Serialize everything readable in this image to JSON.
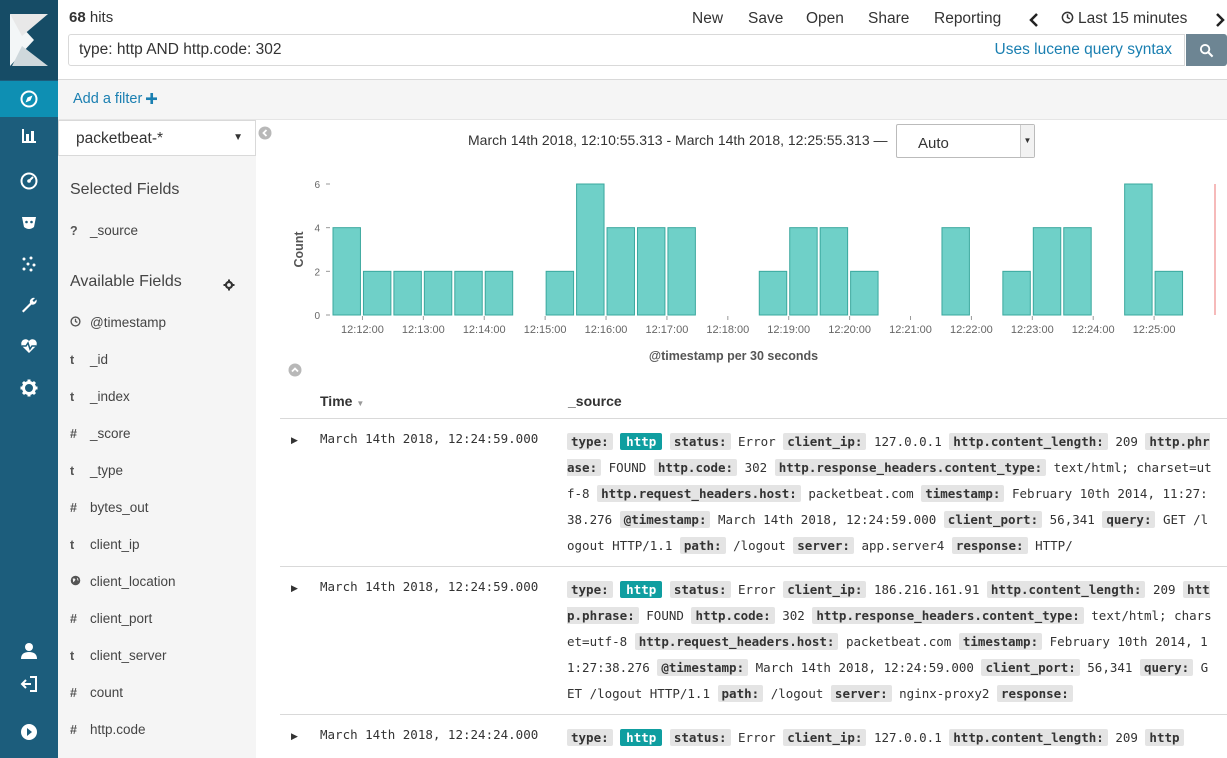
{
  "topbar": {
    "hits_count": "68",
    "hits_label": "hits",
    "links": [
      "New",
      "Save",
      "Open",
      "Share",
      "Reporting"
    ],
    "time_range": "Last 15 minutes",
    "query": "type: http AND http.code: 302",
    "lucene_link": "Uses lucene query syntax"
  },
  "filter_bar": {
    "add_filter": "Add a filter"
  },
  "sidebar": {
    "index_pattern": "packetbeat-*",
    "selected_heading": "Selected Fields",
    "selected_fields": [
      {
        "type": "?",
        "name": "_source"
      }
    ],
    "available_heading": "Available Fields",
    "available_fields": [
      {
        "type": "clock",
        "name": "@timestamp"
      },
      {
        "type": "t",
        "name": "_id"
      },
      {
        "type": "t",
        "name": "_index"
      },
      {
        "type": "#",
        "name": "_score"
      },
      {
        "type": "t",
        "name": "_type"
      },
      {
        "type": "#",
        "name": "bytes_out"
      },
      {
        "type": "t",
        "name": "client_ip"
      },
      {
        "type": "globe",
        "name": "client_location"
      },
      {
        "type": "#",
        "name": "client_port"
      },
      {
        "type": "t",
        "name": "client_server"
      },
      {
        "type": "#",
        "name": "count"
      },
      {
        "type": "#",
        "name": "http.code"
      }
    ]
  },
  "main": {
    "range_text": "March 14th 2018, 12:10:55.313 - March 14th 2018, 12:25:55.313 —",
    "interval": "Auto",
    "table_headers": {
      "time": "Time",
      "source": "_source"
    }
  },
  "colors": {
    "bar": "#6fd0c8",
    "bar_border": "#3aa89e",
    "nav": "#1c5d7c",
    "nav_active": "#0e8fb3",
    "link": "#1a7fb1",
    "highlight": "#0f9ea0"
  },
  "chart_data": {
    "type": "bar",
    "title": "",
    "xlabel": "@timestamp per 30 seconds",
    "ylabel": "Count",
    "ylim": [
      0,
      6
    ],
    "yticks": [
      0,
      2,
      4,
      6
    ],
    "x_ticks": [
      "12:12:00",
      "12:13:00",
      "12:14:00",
      "12:15:00",
      "12:16:00",
      "12:17:00",
      "12:18:00",
      "12:19:00",
      "12:20:00",
      "12:21:00",
      "12:22:00",
      "12:23:00",
      "12:24:00",
      "12:25:00"
    ],
    "categories": [
      "12:11:30",
      "12:12:00",
      "12:12:30",
      "12:13:00",
      "12:13:30",
      "12:14:00",
      "12:14:30",
      "12:15:00",
      "12:15:30",
      "12:16:00",
      "12:16:30",
      "12:17:00",
      "12:17:30",
      "12:18:00",
      "12:18:30",
      "12:19:00",
      "12:19:30",
      "12:20:00",
      "12:20:30",
      "12:21:00",
      "12:21:30",
      "12:22:00",
      "12:22:30",
      "12:23:00",
      "12:23:30",
      "12:24:00",
      "12:24:30",
      "12:25:00",
      "12:25:30"
    ],
    "values": [
      4,
      2,
      2,
      2,
      2,
      2,
      0,
      2,
      6,
      4,
      4,
      4,
      0,
      0,
      2,
      4,
      4,
      2,
      0,
      0,
      4,
      0,
      2,
      4,
      4,
      0,
      6,
      2,
      0
    ],
    "grid": false
  },
  "documents": [
    {
      "time": "March 14th 2018, 12:24:59.000",
      "fields": [
        {
          "k": "type:",
          "v": "http",
          "hl": true
        },
        {
          "k": "status:",
          "v": "Error"
        },
        {
          "k": "client_ip:",
          "v": "127.0.0.1"
        },
        {
          "k": "http.content_length:",
          "v": "209"
        },
        {
          "k": "http.phrase:",
          "v": "FOUND"
        },
        {
          "k": "http.code:",
          "v": "302"
        },
        {
          "k": "http.response_headers.content_type:",
          "v": "text/html; charset=utf-8"
        },
        {
          "k": "http.request_headers.host:",
          "v": "packetbeat.com"
        },
        {
          "k": "timestamp:",
          "v": "February 10th 2014, 11:27:38.276"
        },
        {
          "k": "@timestamp:",
          "v": "March 14th 2018, 12:24:59.000"
        },
        {
          "k": "client_port:",
          "v": "56,341"
        },
        {
          "k": "query:",
          "v": "GET /logout HTTP/1.1"
        },
        {
          "k": "path:",
          "v": "/logout"
        },
        {
          "k": "server:",
          "v": "app.server4"
        },
        {
          "k": "response:",
          "v": "HTTP/"
        }
      ]
    },
    {
      "time": "March 14th 2018, 12:24:59.000",
      "fields": [
        {
          "k": "type:",
          "v": "http",
          "hl": true
        },
        {
          "k": "status:",
          "v": "Error"
        },
        {
          "k": "client_ip:",
          "v": "186.216.161.91"
        },
        {
          "k": "http.content_length:",
          "v": "209"
        },
        {
          "k": "http.phrase:",
          "v": "FOUND"
        },
        {
          "k": "http.code:",
          "v": "302"
        },
        {
          "k": "http.response_headers.content_type:",
          "v": "text/html; charset=utf-8"
        },
        {
          "k": "http.request_headers.host:",
          "v": "packetbeat.com"
        },
        {
          "k": "timestamp:",
          "v": "February 10th 2014, 11:27:38.276"
        },
        {
          "k": "@timestamp:",
          "v": "March 14th 2018, 12:24:59.000"
        },
        {
          "k": "client_port:",
          "v": "56,341"
        },
        {
          "k": "query:",
          "v": "GET /logout HTTP/1.1"
        },
        {
          "k": "path:",
          "v": "/logout"
        },
        {
          "k": "server:",
          "v": "nginx-proxy2"
        },
        {
          "k": "response:",
          "v": ""
        }
      ]
    },
    {
      "time": "March 14th 2018, 12:24:24.000",
      "fields": [
        {
          "k": "type:",
          "v": "http",
          "hl": true
        },
        {
          "k": "status:",
          "v": "Error"
        },
        {
          "k": "client_ip:",
          "v": "127.0.0.1"
        },
        {
          "k": "http.content_length:",
          "v": "209"
        },
        {
          "k": "http",
          "v": ""
        }
      ]
    }
  ]
}
